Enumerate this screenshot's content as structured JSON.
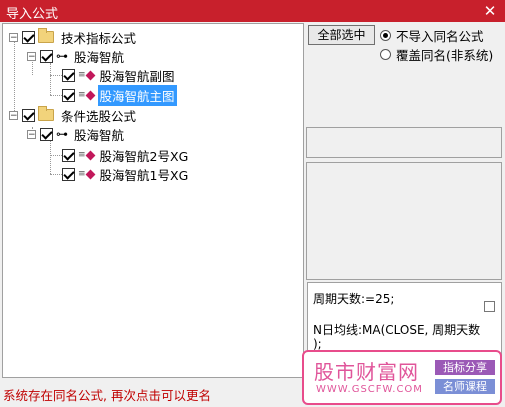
{
  "window": {
    "title": "导入公式",
    "close_glyph": "✕"
  },
  "tree": {
    "nodes": [
      {
        "id": "n1",
        "type": "folder",
        "label": "技术指标公式",
        "checked": true
      },
      {
        "id": "n2",
        "type": "key",
        "label": "股海智航",
        "checked": true
      },
      {
        "id": "n3",
        "type": "formula",
        "label": "股海智航副图",
        "checked": true
      },
      {
        "id": "n4",
        "type": "formula",
        "label": "股海智航主图",
        "checked": true,
        "selected": true
      },
      {
        "id": "n5",
        "type": "folder",
        "label": "条件选股公式",
        "checked": true
      },
      {
        "id": "n6",
        "type": "key",
        "label": "股海智航",
        "checked": true
      },
      {
        "id": "n7",
        "type": "formula",
        "label": "股海智航2号XG",
        "checked": true
      },
      {
        "id": "n8",
        "type": "formula",
        "label": "股海智航1号XG",
        "checked": true
      }
    ]
  },
  "controls": {
    "select_all_label": "全部选中",
    "option_skip_label": "不导入同名公式",
    "option_overwrite_label": "覆盖同名(非系统)",
    "selected_option": "skip"
  },
  "code": {
    "line1": "周期天数:=25;",
    "line2": "N日均线:MA(CLOSE, 周期天数",
    "line3": ");"
  },
  "status": {
    "message": "系统存在同名公式, 再次点击可以更名"
  },
  "watermark": {
    "site_name": "股市财富网",
    "url": "WWW.GSCFW.COM",
    "tag1": "指标分享",
    "tag2": "名师课程"
  },
  "colors": {
    "title_bar": "#c8202c",
    "selection": "#3399ff",
    "status_text": "#c00000",
    "watermark": "#e0559a"
  }
}
